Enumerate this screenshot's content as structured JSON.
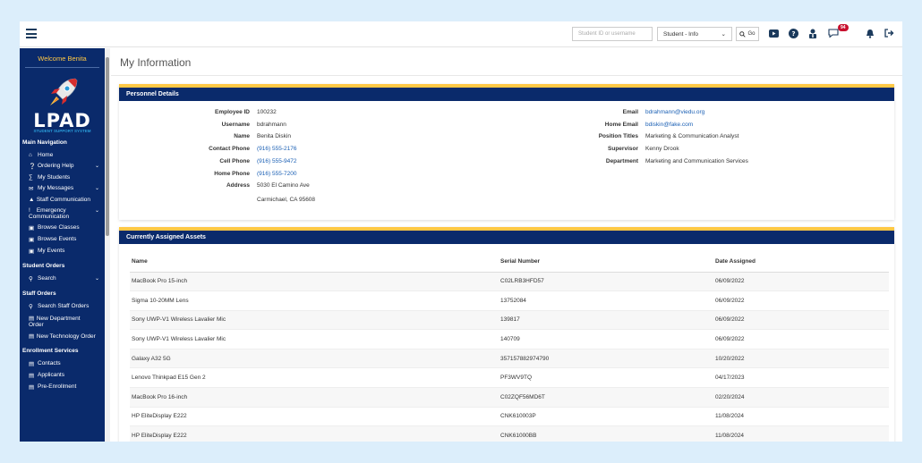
{
  "topbar": {
    "search_placeholder": "Student ID or username",
    "select_value": "Student - Info",
    "go_label": "Go",
    "message_count": "94"
  },
  "sidebar": {
    "welcome": "Welcome Benita",
    "logo_text": "LPAD",
    "logo_sub": "STUDENT SUPPORT SYSTEM",
    "main_nav": "Main Navigation",
    "items_main": [
      {
        "label": "Home",
        "icon": "home-icon"
      },
      {
        "label": "Ordering Help",
        "icon": "question-icon"
      },
      {
        "label": "My Students",
        "icon": "users-icon"
      },
      {
        "label": "My Messages",
        "icon": "envelope-icon"
      },
      {
        "label": "Staff Communication",
        "icon": "megaphone-icon"
      },
      {
        "label": "Emergency Communication",
        "icon": "exclamation-icon"
      },
      {
        "label": "Browse Classes",
        "icon": "calendar-icon"
      },
      {
        "label": "Browse Events",
        "icon": "calendar-icon"
      },
      {
        "label": "My Events",
        "icon": "calendar-icon"
      }
    ],
    "student_orders": "Student Orders",
    "search_label": "Search",
    "staff_orders": "Staff Orders",
    "items_staff": [
      {
        "label": "Search Staff Orders"
      },
      {
        "label": "New Department Order"
      },
      {
        "label": "New Technology Order"
      }
    ],
    "enrollment": "Enrollment Services",
    "items_enroll": [
      {
        "label": "Contacts"
      },
      {
        "label": "Applicants"
      },
      {
        "label": "Pre-Enrollment"
      }
    ]
  },
  "page": {
    "title": "My Information"
  },
  "personnel": {
    "header": "Personnel Details",
    "left": [
      {
        "key": "Employee ID",
        "value": "100232"
      },
      {
        "key": "Username",
        "value": "bdrahmann"
      },
      {
        "key": "Name",
        "value": "Benita Diskin"
      },
      {
        "key": "Contact Phone",
        "value": "(916) 555-2176"
      },
      {
        "key": "Cell Phone",
        "value": "(916) 555-9472"
      },
      {
        "key": "Home Phone",
        "value": "(916) 555-7200"
      },
      {
        "key": "Address",
        "value": "5030 El Camino Ave"
      }
    ],
    "address_line2": "Carmichael, CA 95608",
    "right": [
      {
        "key": "Email",
        "value": "bdrahmann@viedu.org"
      },
      {
        "key": "Home Email",
        "value": "bdiskin@fake.com"
      },
      {
        "key": "Position Titles",
        "value": "Marketing & Communication Analyst"
      },
      {
        "key": "Supervisor",
        "value": "Kenny Drook"
      },
      {
        "key": "Department",
        "value": "Marketing and Communication Services"
      }
    ]
  },
  "assets": {
    "header": "Currently Assigned Assets",
    "columns": [
      "Name",
      "Serial Number",
      "Date Assigned"
    ],
    "rows": [
      [
        "MacBook Pro 15-inch",
        "C02LRB3HFD57",
        "06/09/2022"
      ],
      [
        "Sigma 10-20MM Lens",
        "13752084",
        "06/09/2022"
      ],
      [
        "Sony UWP-V1 Wireless Lavalier Mic",
        "139817",
        "06/09/2022"
      ],
      [
        "Sony UWP-V1 Wireless Lavalier Mic",
        "140709",
        "06/09/2022"
      ],
      [
        "Galaxy A32 5G",
        "357157882974790",
        "10/20/2022"
      ],
      [
        "Lenovo Thinkpad E15 Gen 2",
        "PF3WV9TQ",
        "04/17/2023"
      ],
      [
        "MacBook Pro 16-inch",
        "C02ZQF56MD6T",
        "02/20/2024"
      ],
      [
        "HP EliteDisplay E222",
        "CNK610003P",
        "11/08/2024"
      ],
      [
        "HP EliteDisplay E222",
        "CNK61000BB",
        "11/08/2024"
      ]
    ]
  }
}
